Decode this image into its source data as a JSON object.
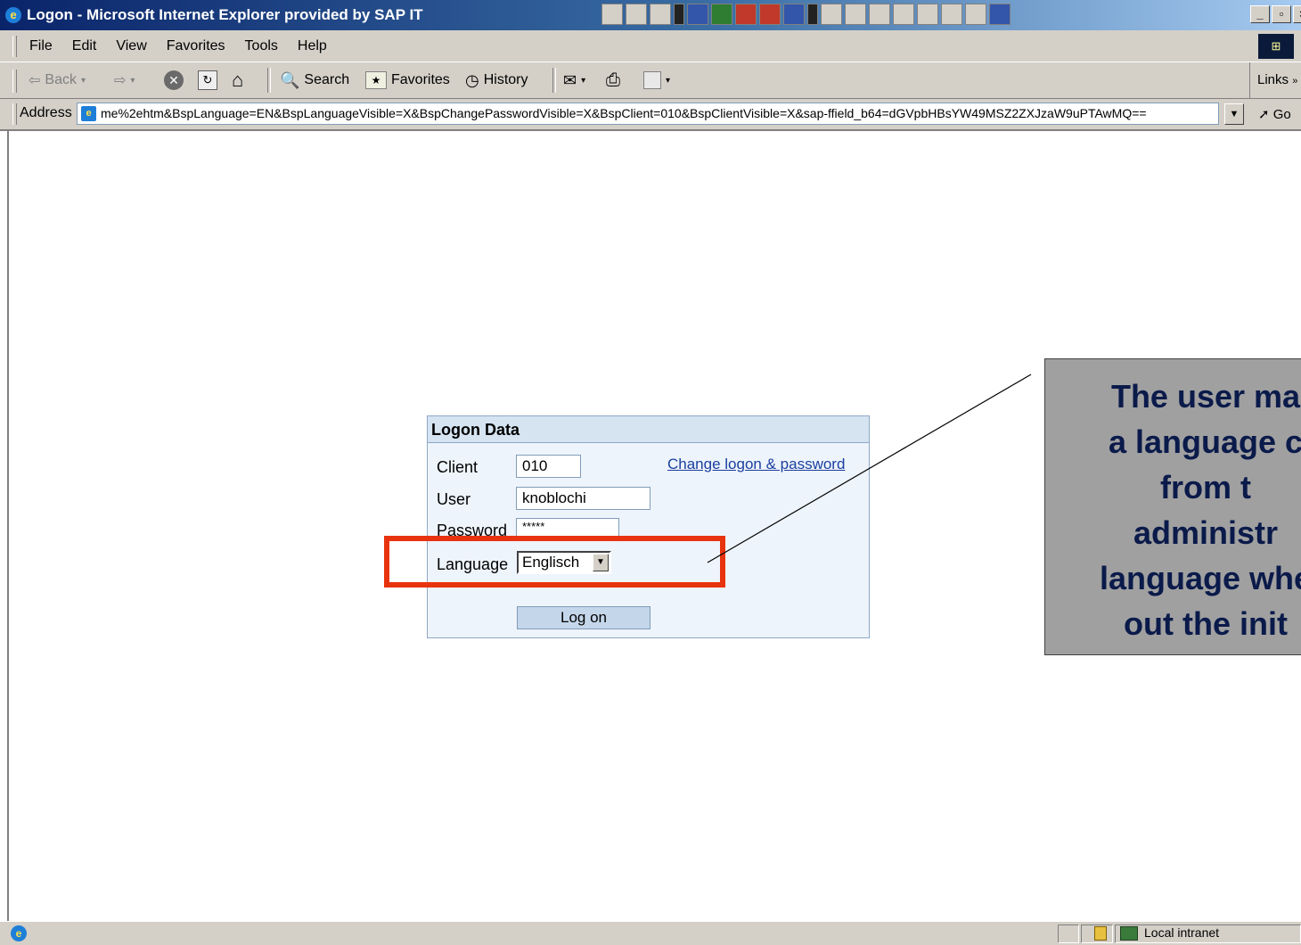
{
  "window": {
    "title": "Logon - Microsoft Internet Explorer provided by SAP IT"
  },
  "menu": {
    "items": [
      "File",
      "Edit",
      "View",
      "Favorites",
      "Tools",
      "Help"
    ]
  },
  "toolbar": {
    "back_label": "Back",
    "search_label": "Search",
    "favorites_label": "Favorites",
    "history_label": "History",
    "links_label": "Links"
  },
  "address": {
    "label": "Address",
    "url": "me%2ehtm&BspLanguage=EN&BspLanguageVisible=X&BspChangePasswordVisible=X&BspClient=010&BspClientVisible=X&sap-ffield_b64=dGVpbHBsYW49MSZ2ZXJzaW9uPTAwMQ==",
    "go_label": "Go"
  },
  "logon": {
    "header": "Logon Data",
    "client_label": "Client",
    "client_value": "010",
    "user_label": "User",
    "user_value": "knoblochi",
    "password_label": "Password",
    "password_value": "*****",
    "language_label": "Language",
    "language_value": "Englisch",
    "change_link": "Change logon & password",
    "logon_button": "Log on"
  },
  "callout": {
    "lines": [
      "The user ma",
      "a language c",
      "from t",
      "administr",
      "language whe",
      "out the init"
    ]
  },
  "status": {
    "zone": "Local intranet"
  },
  "colors": {
    "highlight": "#e8330f",
    "callout_bg": "#a0a0a0",
    "callout_text": "#0a1a4a",
    "titlebar": "#0a246a"
  }
}
